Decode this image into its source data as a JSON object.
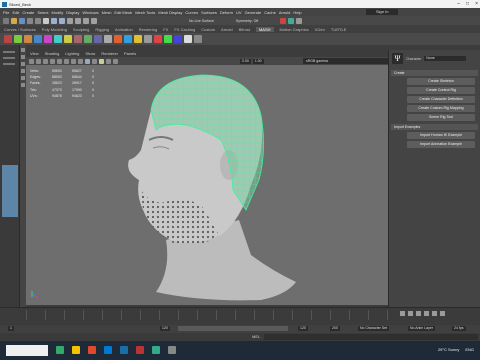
{
  "titlebar": {
    "title": "Sliced_Beck"
  },
  "menubar": {
    "items": [
      "File",
      "Edit",
      "Create",
      "Select",
      "Modify",
      "Display",
      "Windows",
      "Mesh",
      "Edit Mesh",
      "Mesh Tools",
      "Mesh Display",
      "Curves",
      "Surfaces",
      "Deform",
      "UV",
      "Generate",
      "Cache",
      "Arnold",
      "Help"
    ],
    "live_surface": "No Live Surface",
    "symmetry": "Symmetry: Off",
    "sign_in": "Sign In"
  },
  "shelf_tabs": [
    "Curves / Surfaces",
    "Poly Modeling",
    "Sculpting",
    "Rigging",
    "Animation",
    "Rendering",
    "FX",
    "FX Caching",
    "Custom",
    "Arnold",
    "Bifrost",
    "MASH",
    "Motion Graphics",
    "XGen",
    "TURTLE"
  ],
  "active_shelf_tab": "MASH",
  "panel_menu": [
    "View",
    "Shading",
    "Lighting",
    "Show",
    "Renderer",
    "Panels"
  ],
  "view_bar": {
    "field1": "0.00",
    "field2": "1.00",
    "gamma": "sRGB gamma"
  },
  "hud": {
    "header": [
      "",
      "",
      ""
    ],
    "rows": [
      {
        "label": "Verts:",
        "v1": "55693",
        "v2": "55627",
        "v3": "0"
      },
      {
        "label": "Edges:",
        "v1": "68000",
        "v2": "66644",
        "v3": "0"
      },
      {
        "label": "Faces:",
        "v1": "28623",
        "v2": "26917",
        "v3": "0"
      },
      {
        "label": "Tris:",
        "v1": "47373",
        "v2": "17990",
        "v3": "0"
      },
      {
        "label": "UVs:",
        "v1": "94878",
        "v2": "94623",
        "v3": "0"
      }
    ]
  },
  "right_panel": {
    "character_label": "Character",
    "character_value": "None",
    "create_section": "Create",
    "buttons": [
      "Create Skeleton",
      "Create Control Rig",
      "Create Character Definition",
      "Create Custom Rig Mapping",
      "Scene Rig Tool"
    ],
    "import_section": "Import Examples",
    "import_buttons": [
      "Import Human IK Example",
      "Import Animation Example"
    ]
  },
  "range": {
    "start": "1",
    "current": "120",
    "end": "120",
    "end2": "200",
    "character_set": "No Character Set",
    "anim_layer": "No Anim Layer",
    "fps": "24 fps"
  },
  "cmdbar": {
    "mel": "MEL"
  },
  "taskbar": {
    "weather": "29°C Sunny",
    "lang": "ENG",
    "time": "",
    "date": ""
  },
  "colors": {
    "wireframe": "#3cf29a",
    "viewport_bg": "#6e6e6e",
    "accent": "#5d85a8"
  }
}
